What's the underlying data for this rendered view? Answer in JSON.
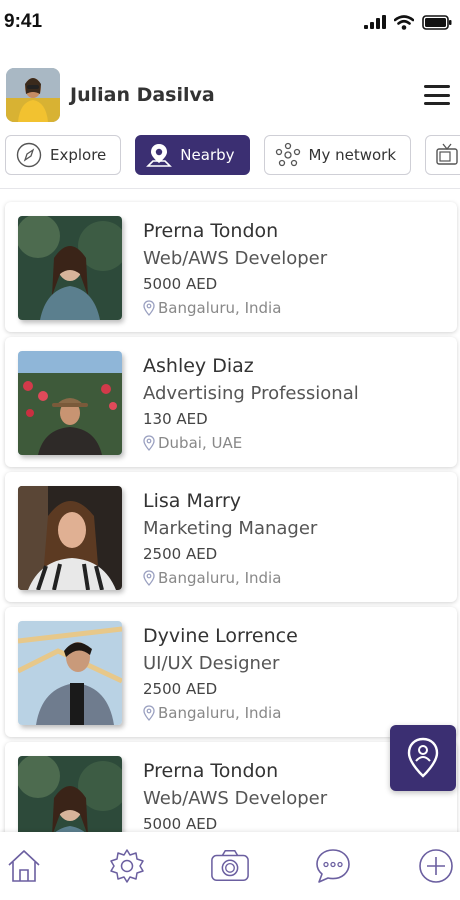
{
  "status": {
    "time": "9:41"
  },
  "user": {
    "name": "Julian Dasilva"
  },
  "tabs": [
    {
      "label": "Explore",
      "icon": "compass-icon",
      "active": false
    },
    {
      "label": "Nearby",
      "icon": "map-pin-icon",
      "active": true
    },
    {
      "label": "My network",
      "icon": "network-icon",
      "active": false
    }
  ],
  "people": [
    {
      "name": "Prerna Tondon",
      "role": "Web/AWS Developer",
      "price": "5000 AED",
      "location": "Bangaluru, India"
    },
    {
      "name": "Ashley Diaz",
      "role": "Advertising Professional",
      "price": "130 AED",
      "location": "Dubai, UAE"
    },
    {
      "name": "Lisa Marry",
      "role": "Marketing Manager",
      "price": "2500 AED",
      "location": "Bangaluru, India"
    },
    {
      "name": "Dyvine Lorrence",
      "role": "UI/UX Designer",
      "price": "2500 AED",
      "location": "Bangaluru, India"
    },
    {
      "name": "Prerna Tondon",
      "role": "Web/AWS Developer",
      "price": "5000 AED",
      "location": ""
    }
  ],
  "bottom_nav": [
    "home-icon",
    "settings-icon",
    "camera-icon",
    "chat-icon",
    "add-icon"
  ],
  "colors": {
    "accent": "#3b2f72",
    "icon": "#6b5fa0"
  }
}
